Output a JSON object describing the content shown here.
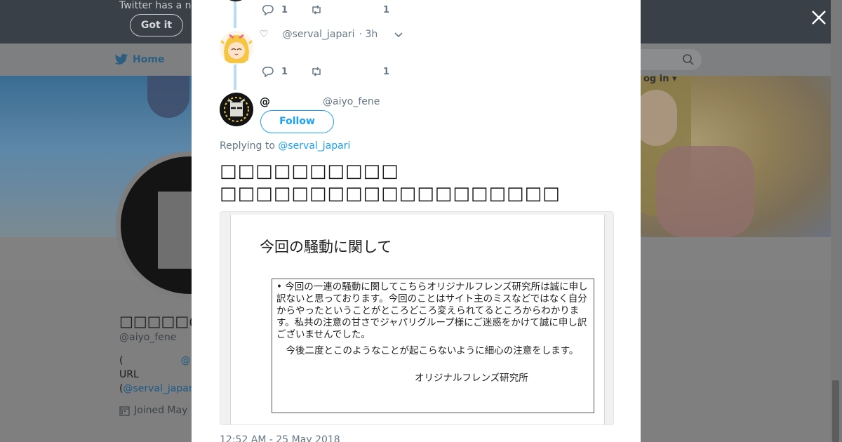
{
  "background_page": {
    "notice_text": "Twitter has a n",
    "got_it_label": "Got it",
    "nav": {
      "home_label": "Home",
      "login_label": "og in ▾"
    },
    "profile": {
      "name": "□□□□□@□□",
      "handle": "@aiyo_fene",
      "bio_line1_prefix": "(",
      "bio_line1_link": "@",
      "bio_line2": "URL",
      "bio_line3_prefix": "(",
      "bio_line3_link": "@serval_japar",
      "joined": "Joined May"
    }
  },
  "modal": {
    "prev_reply_1": {
      "reply_count": "1",
      "like_count": "1"
    },
    "prev_reply_2": {
      "heart": "♡",
      "handle": "@serval_japari",
      "time": "· 3h",
      "reply_count": "1",
      "like_count": "1"
    },
    "tweet": {
      "name": "@",
      "handle": "@aiyo_fene",
      "follow_label": "Follow",
      "replying_prefix": "Replying to ",
      "replying_mention": "@serval_japari",
      "text_line1": "□□□□□□□□□□",
      "text_line2": "□□□□□□□□□□□□□□□□□□□",
      "image": {
        "title": "今回の騒動に関して",
        "paragraph1": "• 今回の一連の騒動に関してこちらオリジナルフレンズ研究所は誠に申し訳ないと思っております。今回のことはサイト主のミスなどではなく自分からやったということがところどころ変えられてるところからわかります。私共の注意の甘さでジャパリグループ様にご迷惑をかけて誠に申し訳ございませんでした。",
        "paragraph2": "今後二度とこのようなことが起こらないように細心の注意をします。",
        "signature": "オリジナルフレンズ研究所"
      },
      "timestamp": "12:52 AM - 25 May 2018"
    }
  },
  "colors": {
    "accent": "#1da1f2",
    "thread_line": "#b8dcf3",
    "muted_text": "#657786",
    "overlay": "#7f7f7f"
  },
  "icons": [
    "twitter-bird-icon",
    "search-icon",
    "close-icon",
    "reply-icon",
    "retweet-icon",
    "chevron-down-icon",
    "calendar-icon"
  ]
}
